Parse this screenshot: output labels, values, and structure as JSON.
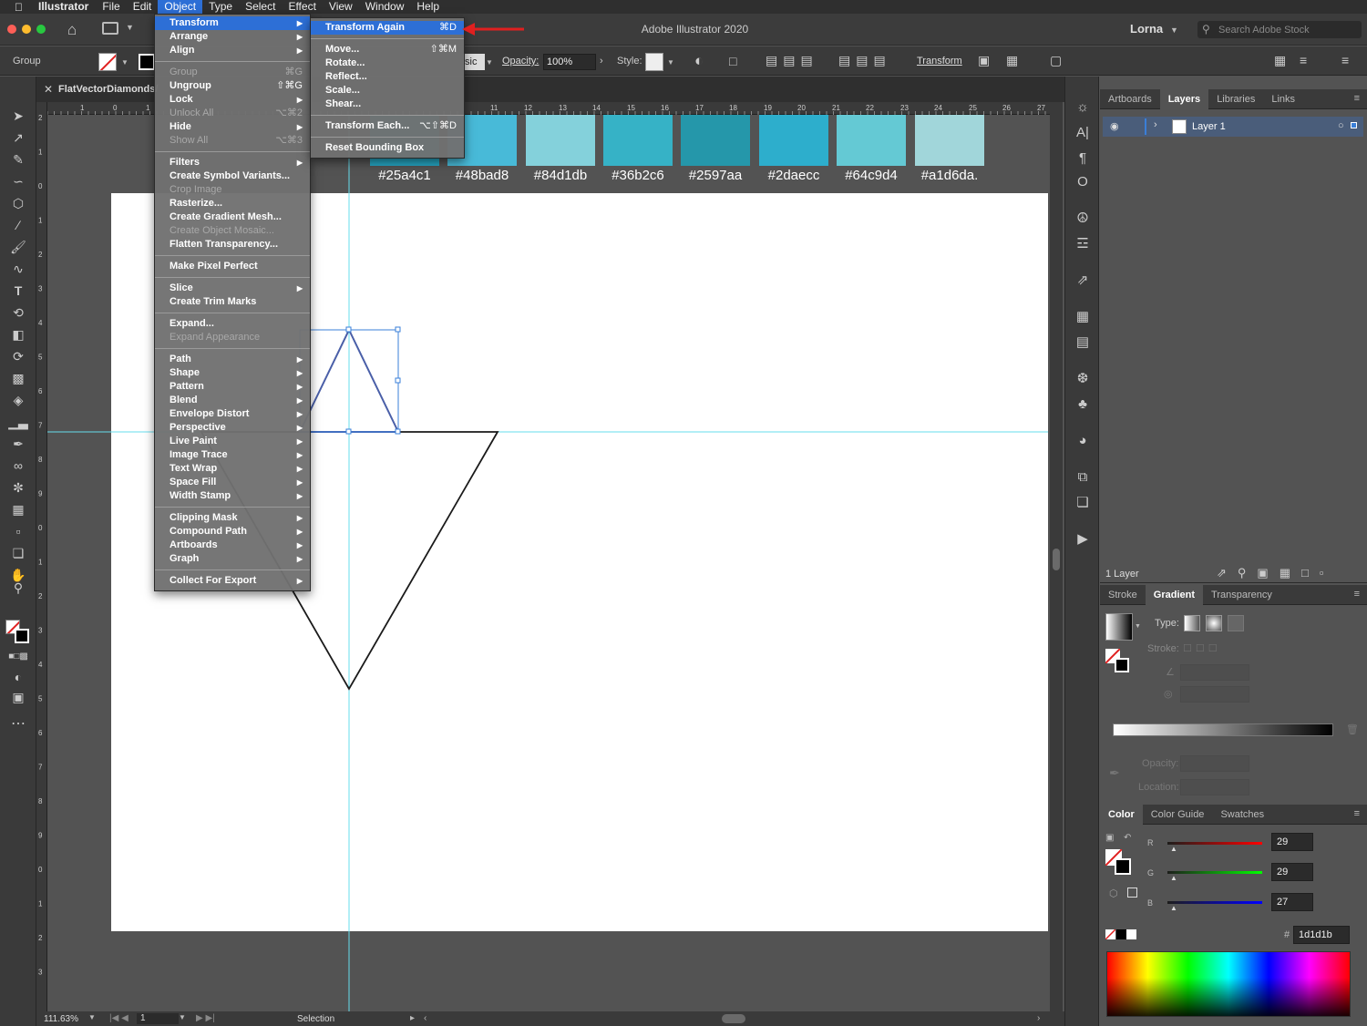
{
  "menubar": {
    "apple": "",
    "app": "Illustrator",
    "items": [
      "File",
      "Edit",
      "Object",
      "Type",
      "Select",
      "Effect",
      "View",
      "Window",
      "Help"
    ]
  },
  "titlebar": {
    "title": "Adobe Illustrator 2020",
    "user": "Lorna",
    "search_placeholder": "Search Adobe Stock"
  },
  "controlbar": {
    "selection_type": "Group",
    "blend_partial": "sic",
    "opacity_label": "Opacity:",
    "opacity_value": "100%",
    "style_label": "Style:",
    "transform_label": "Transform"
  },
  "document": {
    "tab_name": "FlatVectorDiamonds/"
  },
  "rulers": {
    "top_ticks": [
      "1",
      "0",
      "1",
      "11",
      "12",
      "13",
      "14",
      "15",
      "16",
      "17",
      "18",
      "19",
      "20",
      "21",
      "22",
      "23",
      "24",
      "25",
      "26",
      "27"
    ],
    "left_ticks": [
      "2",
      "1",
      "0",
      "1",
      "2",
      "3",
      "4",
      "5",
      "6",
      "7",
      "8",
      "9",
      "0",
      "1",
      "2",
      "3",
      "4",
      "5",
      "6",
      "7",
      "8",
      "9",
      "0",
      "1",
      "2",
      "3"
    ]
  },
  "swatches": [
    {
      "hex": "#25a4c1",
      "label": "#25a4c1"
    },
    {
      "hex": "#48bad8",
      "label": "#48bad8"
    },
    {
      "hex": "#84d1db",
      "label": "#84d1db"
    },
    {
      "hex": "#36b2c6",
      "label": "#36b2c6"
    },
    {
      "hex": "#2597aa",
      "label": "#2597aa"
    },
    {
      "hex": "#2daecc",
      "label": "#2daecc"
    },
    {
      "hex": "#64c9d4",
      "label": "#64c9d4"
    },
    {
      "hex": "#a1d6da",
      "label": "#a1d6da."
    }
  ],
  "object_menu": {
    "items": [
      {
        "label": "Transform",
        "shortcut": "",
        "submenu": true,
        "disabled": false,
        "highlighted": true
      },
      {
        "label": "Arrange",
        "shortcut": "",
        "submenu": true,
        "disabled": false
      },
      {
        "label": "Align",
        "shortcut": "",
        "submenu": true,
        "disabled": false
      },
      {
        "sep": true
      },
      {
        "label": "Group",
        "shortcut": "⌘G",
        "submenu": false,
        "disabled": true
      },
      {
        "label": "Ungroup",
        "shortcut": "⇧⌘G",
        "submenu": false,
        "disabled": false
      },
      {
        "label": "Lock",
        "shortcut": "",
        "submenu": true,
        "disabled": false
      },
      {
        "label": "Unlock All",
        "shortcut": "⌥⌘2",
        "submenu": false,
        "disabled": true
      },
      {
        "label": "Hide",
        "shortcut": "",
        "submenu": true,
        "disabled": false
      },
      {
        "label": "Show All",
        "shortcut": "⌥⌘3",
        "submenu": false,
        "disabled": true
      },
      {
        "sep": true
      },
      {
        "label": "Filters",
        "shortcut": "",
        "submenu": true,
        "disabled": false
      },
      {
        "label": "Create Symbol Variants...",
        "shortcut": "",
        "submenu": false,
        "disabled": false
      },
      {
        "label": "Crop Image",
        "shortcut": "",
        "submenu": false,
        "disabled": true
      },
      {
        "label": "Rasterize...",
        "shortcut": "",
        "submenu": false,
        "disabled": false
      },
      {
        "label": "Create Gradient Mesh...",
        "shortcut": "",
        "submenu": false,
        "disabled": false
      },
      {
        "label": "Create Object Mosaic...",
        "shortcut": "",
        "submenu": false,
        "disabled": true
      },
      {
        "label": "Flatten Transparency...",
        "shortcut": "",
        "submenu": false,
        "disabled": false
      },
      {
        "sep": true
      },
      {
        "label": "Make Pixel Perfect",
        "shortcut": "",
        "submenu": false,
        "disabled": false
      },
      {
        "sep": true
      },
      {
        "label": "Slice",
        "shortcut": "",
        "submenu": true,
        "disabled": false
      },
      {
        "label": "Create Trim Marks",
        "shortcut": "",
        "submenu": false,
        "disabled": false
      },
      {
        "sep": true
      },
      {
        "label": "Expand...",
        "shortcut": "",
        "submenu": false,
        "disabled": false
      },
      {
        "label": "Expand Appearance",
        "shortcut": "",
        "submenu": false,
        "disabled": true
      },
      {
        "sep": true
      },
      {
        "label": "Path",
        "shortcut": "",
        "submenu": true,
        "disabled": false
      },
      {
        "label": "Shape",
        "shortcut": "",
        "submenu": true,
        "disabled": false
      },
      {
        "label": "Pattern",
        "shortcut": "",
        "submenu": true,
        "disabled": false
      },
      {
        "label": "Blend",
        "shortcut": "",
        "submenu": true,
        "disabled": false
      },
      {
        "label": "Envelope Distort",
        "shortcut": "",
        "submenu": true,
        "disabled": false
      },
      {
        "label": "Perspective",
        "shortcut": "",
        "submenu": true,
        "disabled": false
      },
      {
        "label": "Live Paint",
        "shortcut": "",
        "submenu": true,
        "disabled": false
      },
      {
        "label": "Image Trace",
        "shortcut": "",
        "submenu": true,
        "disabled": false
      },
      {
        "label": "Text Wrap",
        "shortcut": "",
        "submenu": true,
        "disabled": false
      },
      {
        "label": "Space Fill",
        "shortcut": "",
        "submenu": true,
        "disabled": false
      },
      {
        "label": "Width Stamp",
        "shortcut": "",
        "submenu": true,
        "disabled": false
      },
      {
        "sep": true
      },
      {
        "label": "Clipping Mask",
        "shortcut": "",
        "submenu": true,
        "disabled": false
      },
      {
        "label": "Compound Path",
        "shortcut": "",
        "submenu": true,
        "disabled": false
      },
      {
        "label": "Artboards",
        "shortcut": "",
        "submenu": true,
        "disabled": false
      },
      {
        "label": "Graph",
        "shortcut": "",
        "submenu": true,
        "disabled": false
      },
      {
        "sep": true
      },
      {
        "label": "Collect For Export",
        "shortcut": "",
        "submenu": true,
        "disabled": false
      }
    ]
  },
  "transform_submenu": {
    "items": [
      {
        "label": "Transform Again",
        "shortcut": "⌘D",
        "highlighted": true
      },
      {
        "sep": true
      },
      {
        "label": "Move...",
        "shortcut": "⇧⌘M"
      },
      {
        "label": "Rotate...",
        "shortcut": ""
      },
      {
        "label": "Reflect...",
        "shortcut": ""
      },
      {
        "label": "Scale...",
        "shortcut": ""
      },
      {
        "label": "Shear...",
        "shortcut": ""
      },
      {
        "sep": true
      },
      {
        "label": "Transform Each...",
        "shortcut": "⌥⇧⌘D"
      },
      {
        "sep": true
      },
      {
        "label": "Reset Bounding Box",
        "shortcut": ""
      }
    ]
  },
  "layers_panel": {
    "tabs": [
      "Artboards",
      "Layers",
      "Libraries",
      "Links"
    ],
    "active_tab": "Layers",
    "layer_name": "Layer 1",
    "footer_count": "1 Layer"
  },
  "gradient_panel": {
    "tabs": [
      "Stroke",
      "Gradient",
      "Transparency"
    ],
    "type_label": "Type:",
    "stroke_label": "Stroke:",
    "opacity_label": "Opacity:",
    "location_label": "Location:"
  },
  "color_panel": {
    "tabs": [
      "Color",
      "Color Guide",
      "Swatches"
    ],
    "r_label": "R",
    "r_value": "29",
    "g_label": "G",
    "g_value": "29",
    "b_label": "B",
    "b_value": "27",
    "hex_prefix": "#",
    "hex_value": "1d1d1b"
  },
  "statusbar": {
    "zoom": "111.63%",
    "artboard_num": "1",
    "tool": "Selection"
  },
  "colors": {
    "accent": "#2d6fd6",
    "guide": "#66ddee",
    "arrow": "#e02020",
    "triangle_stroke": "#4a5fa8"
  }
}
